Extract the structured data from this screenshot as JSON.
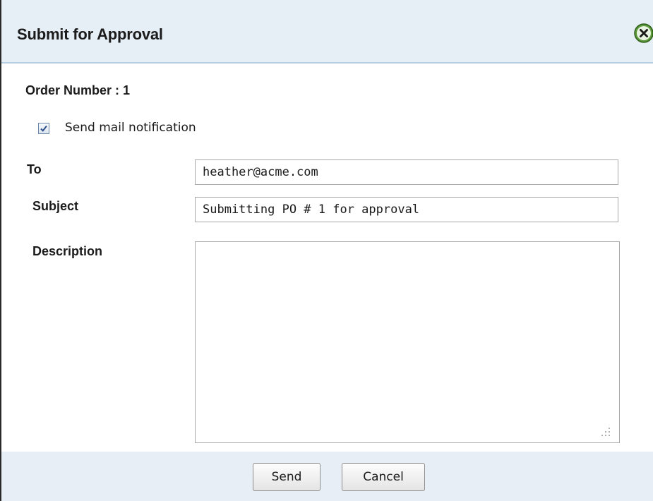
{
  "dialog": {
    "title": "Submit for Approval",
    "close_icon": "close-circle-icon"
  },
  "order": {
    "label": "Order Number : 1"
  },
  "notification": {
    "checked": true,
    "label": "Send mail notification"
  },
  "form": {
    "to_label": "To",
    "to_value": "heather@acme.com",
    "subject_label": "Subject",
    "subject_value": "Submitting PO # 1 for approval",
    "description_label": "Description",
    "description_value": ""
  },
  "buttons": {
    "send_label": "Send",
    "cancel_label": "Cancel"
  },
  "colors": {
    "titlebar": "#e6eef6",
    "footer": "#e8eef5",
    "close_icon": "#4d8a2e"
  }
}
